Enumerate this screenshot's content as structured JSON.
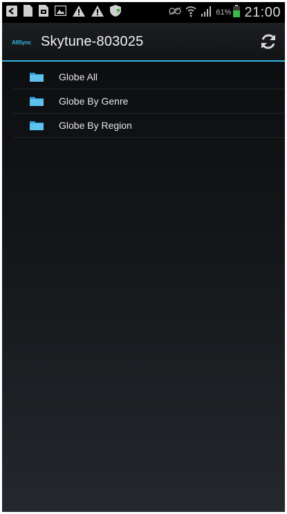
{
  "status_bar": {
    "battery_percent": "61%",
    "time": "21:00",
    "left_icons": [
      "back-notification-icon",
      "file-icon",
      "sd-card-icon",
      "image-icon",
      "warning-icon",
      "warning-icon",
      "shield-icon"
    ],
    "right_icons": [
      "no-sim-icon",
      "wifi-icon",
      "signal-icon",
      "battery-icon"
    ]
  },
  "action_bar": {
    "app_logo": "AllSync",
    "title": "Skytune-803025",
    "refresh_icon": "refresh-icon",
    "accent_color": "#33b5e5"
  },
  "folders": [
    {
      "label": "Globe All",
      "icon": "folder-icon"
    },
    {
      "label": "Globe By Genre",
      "icon": "folder-icon"
    },
    {
      "label": "Globe By Region",
      "icon": "folder-icon"
    }
  ]
}
